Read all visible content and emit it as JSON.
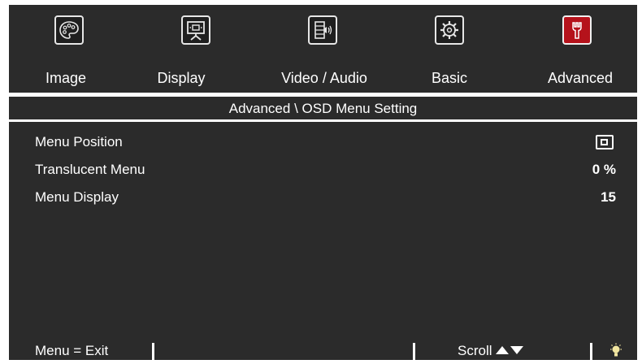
{
  "tabs": [
    {
      "label": "Image",
      "icon": "palette-icon",
      "active": false
    },
    {
      "label": "Display",
      "icon": "display-icon",
      "active": false
    },
    {
      "label": "Video / Audio",
      "icon": "video-audio-icon",
      "active": false
    },
    {
      "label": "Basic",
      "icon": "gear-icon",
      "active": false
    },
    {
      "label": "Advanced",
      "icon": "wrench-icon",
      "active": true
    }
  ],
  "breadcrumb": "Advanced \\ OSD Menu Setting",
  "settings": [
    {
      "label": "Menu Position",
      "value": "",
      "icon": "menu-position-icon"
    },
    {
      "label": "Translucent Menu",
      "value": "0 %"
    },
    {
      "label": "Menu Display",
      "value": "15"
    }
  ],
  "footer": {
    "exit_hint": "Menu = Exit",
    "scroll_hint": "Scroll",
    "lamp_icon": "lamp-icon"
  },
  "colors": {
    "background": "#2b2b2b",
    "text": "#ffffff",
    "active_tab": "#b5121b"
  }
}
